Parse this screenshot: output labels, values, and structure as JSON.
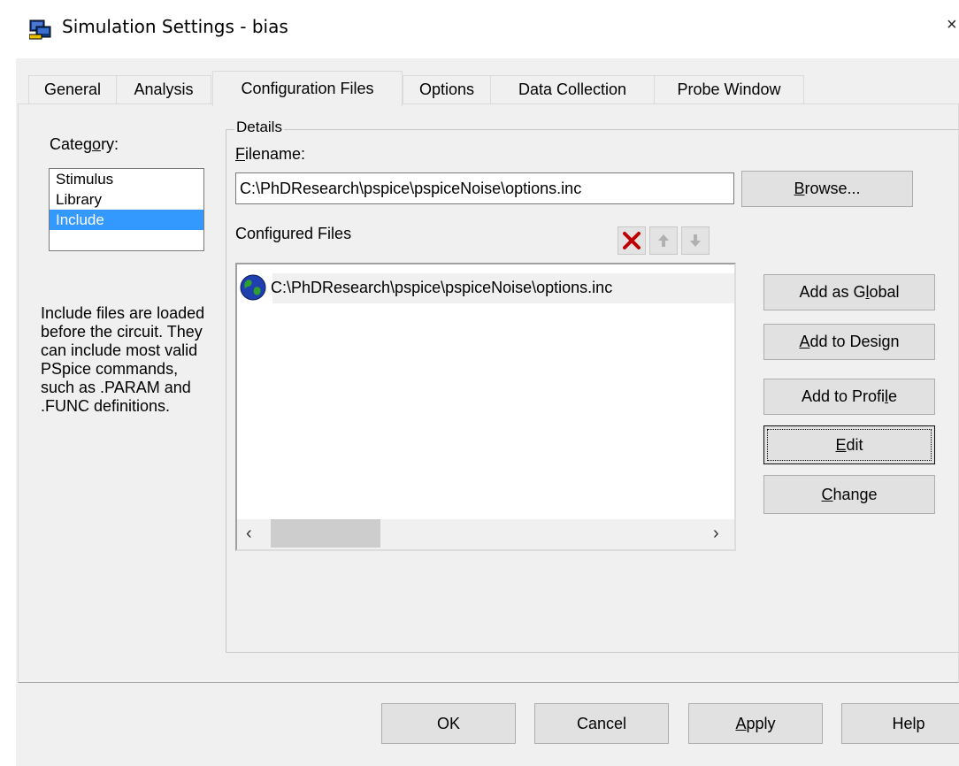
{
  "window": {
    "title": "Simulation Settings - bias",
    "close_glyph": "×"
  },
  "tabs": [
    {
      "label": "General"
    },
    {
      "label": "Analysis"
    },
    {
      "label": "Configuration Files",
      "active": true
    },
    {
      "label": "Options"
    },
    {
      "label": "Data Collection"
    },
    {
      "label": "Probe Window"
    }
  ],
  "category": {
    "label_pre": "Categ",
    "label_u": "o",
    "label_post": "ry:",
    "items": [
      "Stimulus",
      "Library",
      "Include"
    ],
    "selected": "Include",
    "help_text": "Include files are loaded before the circuit.  They can include most valid PSpice commands, such as .PARAM and .FUNC definitions."
  },
  "details": {
    "legend": "Details",
    "filename_label_u": "F",
    "filename_label_post": "ilename:",
    "filename_value": "C:\\PhDResearch\\pspice\\pspiceNoise\\options.inc",
    "configured_label": "Configured Files",
    "configured_files": [
      "C:\\PhDResearch\\pspice\\pspiceNoise\\options.inc"
    ],
    "toolbar_icons": [
      "delete-icon",
      "move-up-icon",
      "move-down-icon"
    ]
  },
  "buttons": {
    "browse_u": "B",
    "browse_post": "rowse...",
    "add_global_pre": "Add as G",
    "add_global_u": "l",
    "add_global_post": "obal",
    "add_design_u": "A",
    "add_design_post": "dd to Design",
    "add_profile_pre": "Add to Profi",
    "add_profile_u": "l",
    "add_profile_post": "e",
    "edit_u": "E",
    "edit_post": "dit",
    "change_u": "C",
    "change_post": "hange"
  },
  "footer": {
    "ok": "OK",
    "cancel": "Cancel",
    "apply_u": "A",
    "apply_post": "pply",
    "help": "Help"
  },
  "colors": {
    "selection": "#3399ff",
    "dialog_bg": "#f0f0f0",
    "delete_red": "#c00000"
  }
}
